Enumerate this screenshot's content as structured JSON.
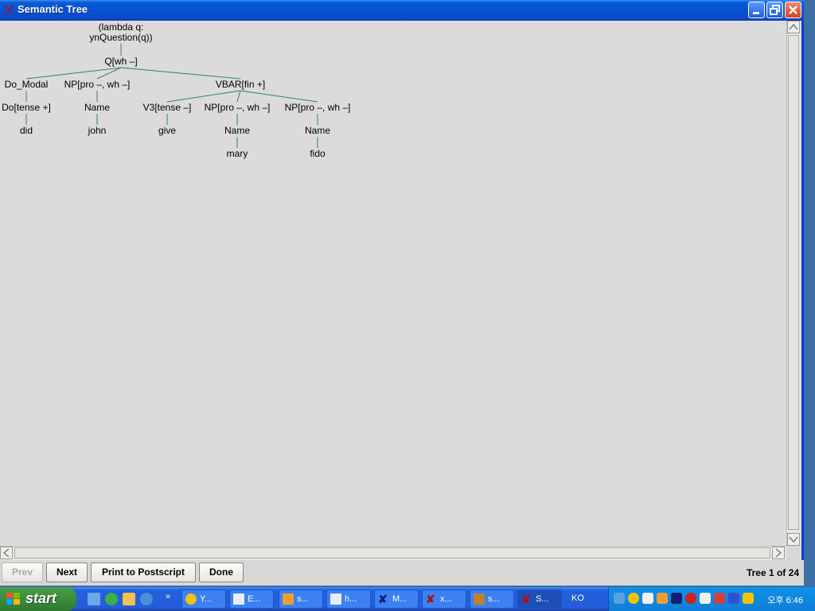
{
  "window": {
    "title": "Semantic Tree"
  },
  "tree": {
    "nodes": [
      {
        "id": "root",
        "lines": [
          "(lambda q:",
          "ynQuestion(q))"
        ]
      },
      {
        "id": "q",
        "label": "Q[wh –]"
      },
      {
        "id": "do_modal",
        "label": "Do_Modal"
      },
      {
        "id": "np1",
        "label": "NP[pro –, wh –]"
      },
      {
        "id": "vbar",
        "label": "VBAR[fin +]"
      },
      {
        "id": "do",
        "label": "Do[tense +]"
      },
      {
        "id": "name1",
        "label": "Name"
      },
      {
        "id": "v3",
        "label": "V3[tense –]"
      },
      {
        "id": "np2",
        "label": "NP[pro –, wh –]"
      },
      {
        "id": "np3",
        "label": "NP[pro –, wh –]"
      },
      {
        "id": "did",
        "label": "did"
      },
      {
        "id": "john",
        "label": "john"
      },
      {
        "id": "give",
        "label": "give"
      },
      {
        "id": "name2",
        "label": "Name"
      },
      {
        "id": "name3",
        "label": "Name"
      },
      {
        "id": "mary",
        "label": "mary"
      },
      {
        "id": "fido",
        "label": "fido"
      }
    ],
    "edges": [
      [
        "root",
        "q"
      ],
      [
        "q",
        "do_modal"
      ],
      [
        "q",
        "np1"
      ],
      [
        "q",
        "vbar"
      ],
      [
        "do_modal",
        "do"
      ],
      [
        "do",
        "did"
      ],
      [
        "np1",
        "name1"
      ],
      [
        "name1",
        "john"
      ],
      [
        "vbar",
        "v3"
      ],
      [
        "vbar",
        "np2"
      ],
      [
        "vbar",
        "np3"
      ],
      [
        "v3",
        "give"
      ],
      [
        "np2",
        "name2"
      ],
      [
        "name2",
        "mary"
      ],
      [
        "np3",
        "name3"
      ],
      [
        "name3",
        "fido"
      ]
    ],
    "edge_color": "#2a8080"
  },
  "buttons": {
    "prev": "Prev",
    "next": "Next",
    "print": "Print to Postscript",
    "done": "Done"
  },
  "status": {
    "tree_count": "Tree 1 of 24"
  },
  "taskbar": {
    "start": "start",
    "tasks": [
      "Y...",
      "E...",
      "s...",
      "h...",
      "M...",
      "x...",
      "s...",
      "S..."
    ],
    "language": "KO",
    "clock": "오후 6:46"
  }
}
